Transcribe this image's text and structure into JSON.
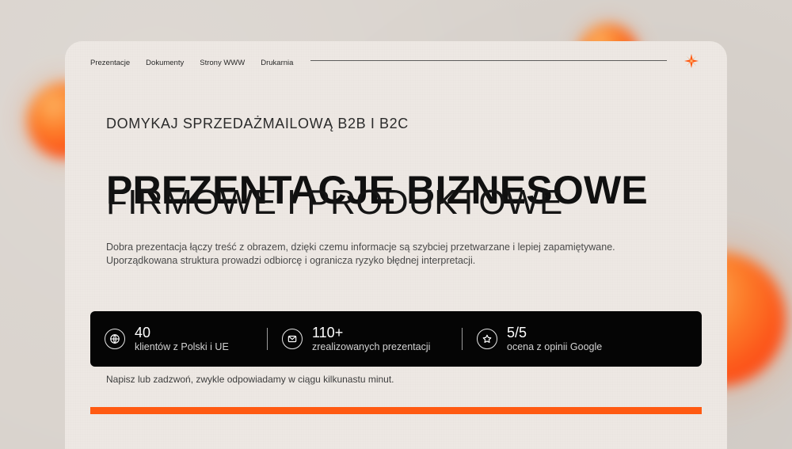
{
  "nav": {
    "items": [
      {
        "label": "Prezentacje"
      },
      {
        "label": "Dokumenty"
      },
      {
        "label": "Strony WWW"
      },
      {
        "label": "Drukarnia"
      }
    ]
  },
  "hero": {
    "kicker": "DOMYKAJ SPRZEDAŻMAILOWĄ B2B I B2C",
    "headline": "PREZENTACJE  BIZNESOWE",
    "subheadline": "FIRMOWE I PRODUKTOWE",
    "description_line_1": "Dobra prezentacja  łączy treść z obrazem, dzięki czemu informacje są szybciej przetwarzane i lepiej zapamiętywane.",
    "description_line_2": "Uporządkowana struktura prowadzi odbiorcę i ogranicza ryzyko błędnej interpretacji."
  },
  "stats": [
    {
      "icon": "globe-icon",
      "value": "40",
      "label": "klientów z Polski i UE"
    },
    {
      "icon": "mail-icon",
      "value": "110+",
      "label": "zrealizowanych prezentacji"
    },
    {
      "icon": "star-icon",
      "value": "5/5",
      "label": "ocena z opinii Google"
    }
  ],
  "contact": {
    "text": "Napisz lub zadzwoń, zwykle odpowiadamy w ciągu kilkunastu minut."
  },
  "colors": {
    "background": "#d9d3cd",
    "card": "#ede8e3",
    "accent": "#ff5a12",
    "text_dark": "#101010",
    "stats_bg": "#050505"
  }
}
